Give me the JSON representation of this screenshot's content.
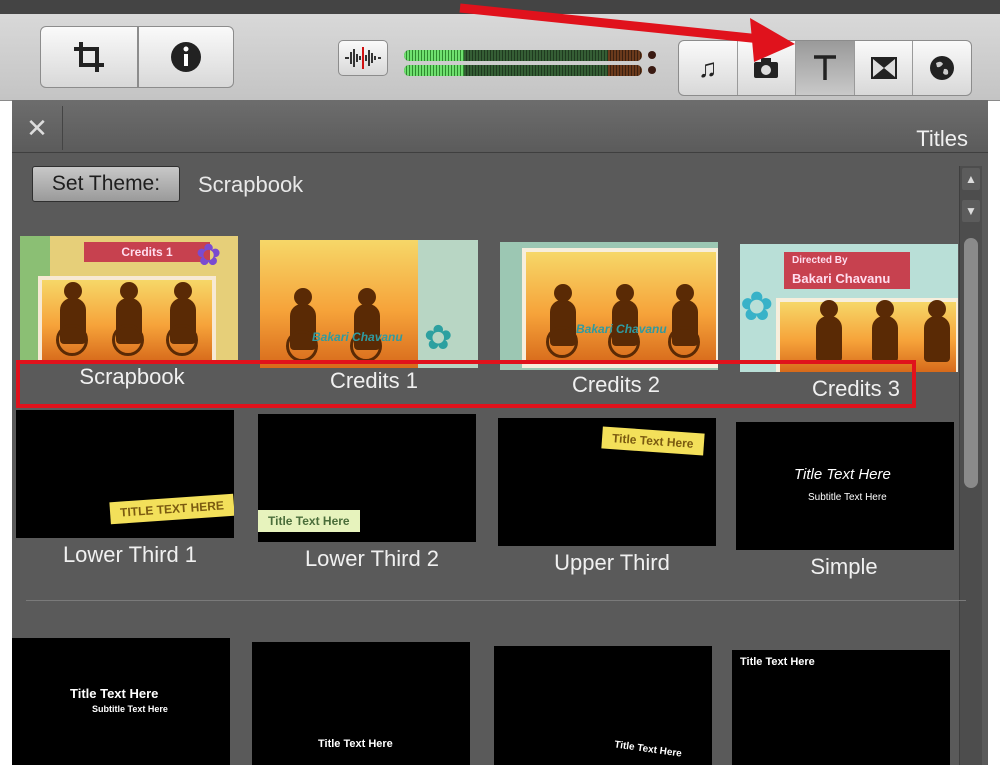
{
  "panel": {
    "title": "Titles",
    "theme_button": "Set Theme:",
    "theme_name": "Scrapbook"
  },
  "toolbar": {
    "icons": [
      "crop-icon",
      "info-icon",
      "waveform-icon",
      "music-icon",
      "camera-icon",
      "title-icon",
      "transition-icon",
      "map-icon"
    ],
    "active": "title-icon"
  },
  "tiles": {
    "row1": [
      "Scrapbook",
      "Credits 1",
      "Credits 2",
      "Credits 3"
    ],
    "row2": [
      "Lower Third 1",
      "Lower Third 2",
      "Upper Third",
      "Simple"
    ]
  },
  "previews": {
    "scrapbook_banner": "Credits 1",
    "credits2_overlay": "Bakari Chavanu",
    "credits1_overlay": "Bakari Chavanu",
    "credits3_top": "Directed By",
    "credits3_name": "Bakari Chavanu",
    "lower_third_1": "TITLE TEXT HERE",
    "lower_third_2": "Title Text Here",
    "upper_third": "Title Text Here",
    "simple_title": "Title Text Here",
    "simple_subtitle": "Subtitle Text Here",
    "row3_1_title": "Title Text Here",
    "row3_1_subtitle": "Subtitle Text Here",
    "row3_2_title": "Title Text Here",
    "row3_3_title": "Title Text Here",
    "row3_4_title": "Title Text Here"
  },
  "colors": {
    "panel_bg": "#5a5a5a",
    "annotation_red": "#e0121c"
  }
}
